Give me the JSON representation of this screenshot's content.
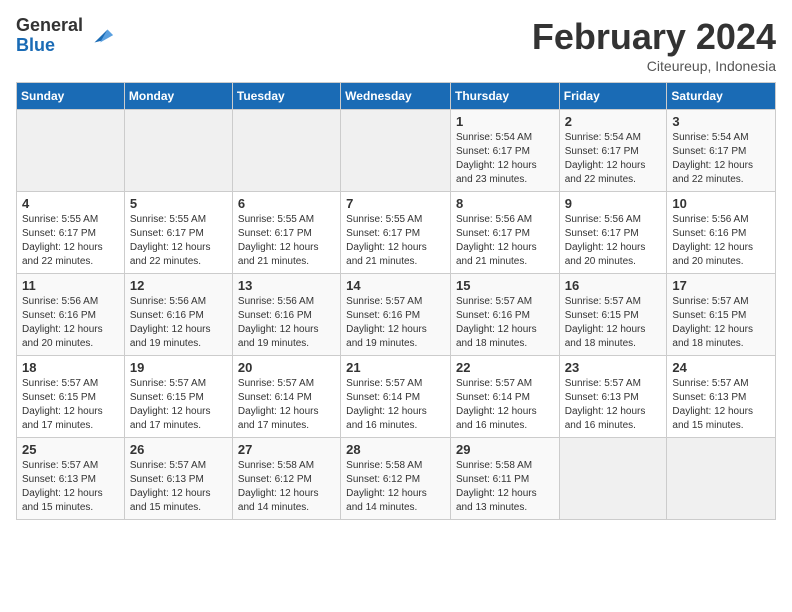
{
  "logo": {
    "general": "General",
    "blue": "Blue"
  },
  "header": {
    "month": "February 2024",
    "location": "Citeureup, Indonesia"
  },
  "weekdays": [
    "Sunday",
    "Monday",
    "Tuesday",
    "Wednesday",
    "Thursday",
    "Friday",
    "Saturday"
  ],
  "weeks": [
    [
      {
        "day": "",
        "sunrise": "",
        "sunset": "",
        "daylight": ""
      },
      {
        "day": "",
        "sunrise": "",
        "sunset": "",
        "daylight": ""
      },
      {
        "day": "",
        "sunrise": "",
        "sunset": "",
        "daylight": ""
      },
      {
        "day": "",
        "sunrise": "",
        "sunset": "",
        "daylight": ""
      },
      {
        "day": "1",
        "sunrise": "Sunrise: 5:54 AM",
        "sunset": "Sunset: 6:17 PM",
        "daylight": "Daylight: 12 hours and 23 minutes."
      },
      {
        "day": "2",
        "sunrise": "Sunrise: 5:54 AM",
        "sunset": "Sunset: 6:17 PM",
        "daylight": "Daylight: 12 hours and 22 minutes."
      },
      {
        "day": "3",
        "sunrise": "Sunrise: 5:54 AM",
        "sunset": "Sunset: 6:17 PM",
        "daylight": "Daylight: 12 hours and 22 minutes."
      }
    ],
    [
      {
        "day": "4",
        "sunrise": "Sunrise: 5:55 AM",
        "sunset": "Sunset: 6:17 PM",
        "daylight": "Daylight: 12 hours and 22 minutes."
      },
      {
        "day": "5",
        "sunrise": "Sunrise: 5:55 AM",
        "sunset": "Sunset: 6:17 PM",
        "daylight": "Daylight: 12 hours and 22 minutes."
      },
      {
        "day": "6",
        "sunrise": "Sunrise: 5:55 AM",
        "sunset": "Sunset: 6:17 PM",
        "daylight": "Daylight: 12 hours and 21 minutes."
      },
      {
        "day": "7",
        "sunrise": "Sunrise: 5:55 AM",
        "sunset": "Sunset: 6:17 PM",
        "daylight": "Daylight: 12 hours and 21 minutes."
      },
      {
        "day": "8",
        "sunrise": "Sunrise: 5:56 AM",
        "sunset": "Sunset: 6:17 PM",
        "daylight": "Daylight: 12 hours and 21 minutes."
      },
      {
        "day": "9",
        "sunrise": "Sunrise: 5:56 AM",
        "sunset": "Sunset: 6:17 PM",
        "daylight": "Daylight: 12 hours and 20 minutes."
      },
      {
        "day": "10",
        "sunrise": "Sunrise: 5:56 AM",
        "sunset": "Sunset: 6:16 PM",
        "daylight": "Daylight: 12 hours and 20 minutes."
      }
    ],
    [
      {
        "day": "11",
        "sunrise": "Sunrise: 5:56 AM",
        "sunset": "Sunset: 6:16 PM",
        "daylight": "Daylight: 12 hours and 20 minutes."
      },
      {
        "day": "12",
        "sunrise": "Sunrise: 5:56 AM",
        "sunset": "Sunset: 6:16 PM",
        "daylight": "Daylight: 12 hours and 19 minutes."
      },
      {
        "day": "13",
        "sunrise": "Sunrise: 5:56 AM",
        "sunset": "Sunset: 6:16 PM",
        "daylight": "Daylight: 12 hours and 19 minutes."
      },
      {
        "day": "14",
        "sunrise": "Sunrise: 5:57 AM",
        "sunset": "Sunset: 6:16 PM",
        "daylight": "Daylight: 12 hours and 19 minutes."
      },
      {
        "day": "15",
        "sunrise": "Sunrise: 5:57 AM",
        "sunset": "Sunset: 6:16 PM",
        "daylight": "Daylight: 12 hours and 18 minutes."
      },
      {
        "day": "16",
        "sunrise": "Sunrise: 5:57 AM",
        "sunset": "Sunset: 6:15 PM",
        "daylight": "Daylight: 12 hours and 18 minutes."
      },
      {
        "day": "17",
        "sunrise": "Sunrise: 5:57 AM",
        "sunset": "Sunset: 6:15 PM",
        "daylight": "Daylight: 12 hours and 18 minutes."
      }
    ],
    [
      {
        "day": "18",
        "sunrise": "Sunrise: 5:57 AM",
        "sunset": "Sunset: 6:15 PM",
        "daylight": "Daylight: 12 hours and 17 minutes."
      },
      {
        "day": "19",
        "sunrise": "Sunrise: 5:57 AM",
        "sunset": "Sunset: 6:15 PM",
        "daylight": "Daylight: 12 hours and 17 minutes."
      },
      {
        "day": "20",
        "sunrise": "Sunrise: 5:57 AM",
        "sunset": "Sunset: 6:14 PM",
        "daylight": "Daylight: 12 hours and 17 minutes."
      },
      {
        "day": "21",
        "sunrise": "Sunrise: 5:57 AM",
        "sunset": "Sunset: 6:14 PM",
        "daylight": "Daylight: 12 hours and 16 minutes."
      },
      {
        "day": "22",
        "sunrise": "Sunrise: 5:57 AM",
        "sunset": "Sunset: 6:14 PM",
        "daylight": "Daylight: 12 hours and 16 minutes."
      },
      {
        "day": "23",
        "sunrise": "Sunrise: 5:57 AM",
        "sunset": "Sunset: 6:13 PM",
        "daylight": "Daylight: 12 hours and 16 minutes."
      },
      {
        "day": "24",
        "sunrise": "Sunrise: 5:57 AM",
        "sunset": "Sunset: 6:13 PM",
        "daylight": "Daylight: 12 hours and 15 minutes."
      }
    ],
    [
      {
        "day": "25",
        "sunrise": "Sunrise: 5:57 AM",
        "sunset": "Sunset: 6:13 PM",
        "daylight": "Daylight: 12 hours and 15 minutes."
      },
      {
        "day": "26",
        "sunrise": "Sunrise: 5:57 AM",
        "sunset": "Sunset: 6:13 PM",
        "daylight": "Daylight: 12 hours and 15 minutes."
      },
      {
        "day": "27",
        "sunrise": "Sunrise: 5:58 AM",
        "sunset": "Sunset: 6:12 PM",
        "daylight": "Daylight: 12 hours and 14 minutes."
      },
      {
        "day": "28",
        "sunrise": "Sunrise: 5:58 AM",
        "sunset": "Sunset: 6:12 PM",
        "daylight": "Daylight: 12 hours and 14 minutes."
      },
      {
        "day": "29",
        "sunrise": "Sunrise: 5:58 AM",
        "sunset": "Sunset: 6:11 PM",
        "daylight": "Daylight: 12 hours and 13 minutes."
      },
      {
        "day": "",
        "sunrise": "",
        "sunset": "",
        "daylight": ""
      },
      {
        "day": "",
        "sunrise": "",
        "sunset": "",
        "daylight": ""
      }
    ]
  ]
}
